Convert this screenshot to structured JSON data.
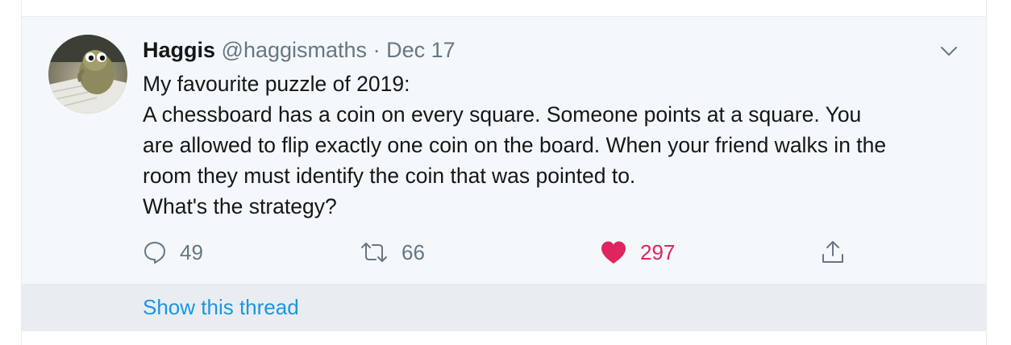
{
  "tweet": {
    "author_name": "Haggis",
    "handle": "@haggismaths",
    "separator": "·",
    "date": "Dec 17",
    "text_lines": [
      "My favourite puzzle of 2019:",
      "A chessboard has a coin on every square. Someone points at a square. You",
      "are allowed to flip exactly one coin on the board. When your friend walks in the",
      "room they must identify the coin that was pointed to.",
      "What's the strategy?"
    ],
    "actions": {
      "reply_count": "49",
      "retweet_count": "66",
      "like_count": "297"
    },
    "icons": {
      "reply": "reply-icon",
      "retweet": "retweet-icon",
      "like": "heart-icon",
      "share": "share-icon",
      "more": "chevron-down-icon"
    }
  },
  "thread": {
    "show_label": "Show this thread"
  },
  "colors": {
    "name": "#14171a",
    "secondary": "#657786",
    "like": "#e0245e",
    "link": "#1b95e0",
    "tweet_bg": "#f5f8fa",
    "thread_bg": "#e9edf1"
  }
}
